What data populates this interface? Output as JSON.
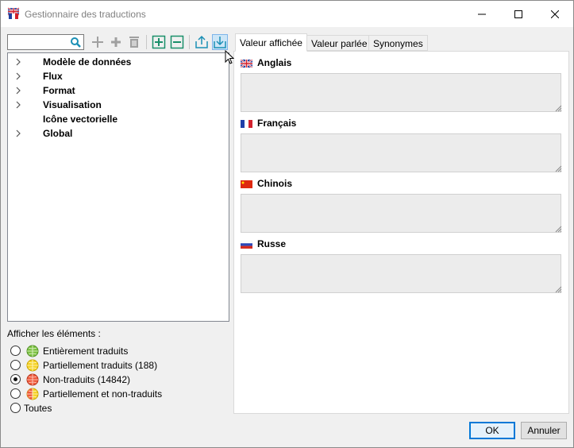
{
  "window": {
    "title": "Gestionnaire des traductions",
    "controls": [
      "minimize",
      "maximize",
      "close"
    ]
  },
  "toolbar": {
    "search_value": "",
    "buttons": [
      {
        "icon": "add-icon",
        "enabled": false
      },
      {
        "icon": "add-child-icon",
        "enabled": false
      },
      {
        "icon": "delete-icon",
        "enabled": false
      },
      {
        "icon": "expand-all-icon",
        "enabled": true
      },
      {
        "icon": "collapse-all-icon",
        "enabled": true
      },
      {
        "icon": "export-icon",
        "enabled": true
      },
      {
        "icon": "import-icon",
        "enabled": true,
        "hovered": true
      }
    ]
  },
  "tree": {
    "items": [
      {
        "label": "Modèle de données",
        "expandable": true
      },
      {
        "label": "Flux",
        "expandable": true
      },
      {
        "label": "Format",
        "expandable": true
      },
      {
        "label": "Visualisation",
        "expandable": true
      },
      {
        "label": "Icône vectorielle",
        "expandable": false
      },
      {
        "label": "Global",
        "expandable": true
      }
    ]
  },
  "filter": {
    "title": "Afficher les éléments :",
    "options": [
      {
        "label": "Entièrement traduits",
        "icon": "globe-green-icon",
        "checked": false
      },
      {
        "label": "Partiellement traduits (188)",
        "icon": "globe-yellow-icon",
        "checked": false
      },
      {
        "label": "Non-traduits (14842)",
        "icon": "globe-red-icon",
        "checked": true
      },
      {
        "label": "Partiellement et non-traduits",
        "icon": "globe-red-yellow-icon",
        "checked": false
      },
      {
        "label": "Toutes",
        "icon": "",
        "checked": false
      }
    ]
  },
  "tabs": [
    {
      "label": "Valeur affichée",
      "active": true
    },
    {
      "label": "Valeur parlée",
      "active": false
    },
    {
      "label": "Synonymes",
      "active": false
    }
  ],
  "languages": [
    {
      "label": "Anglais",
      "flag": "uk-flag-icon",
      "value": ""
    },
    {
      "label": "Français",
      "flag": "france-flag-icon",
      "value": ""
    },
    {
      "label": "Chinois",
      "flag": "china-flag-icon",
      "value": ""
    },
    {
      "label": "Russe",
      "flag": "russia-flag-icon",
      "value": ""
    }
  ],
  "actions": {
    "ok_label": "OK",
    "cancel_label": "Annuler"
  },
  "colors": {
    "accent": "#0078d7",
    "toolbar_icon": "#1a8fb5",
    "disabled_icon": "#a0a0a0"
  }
}
